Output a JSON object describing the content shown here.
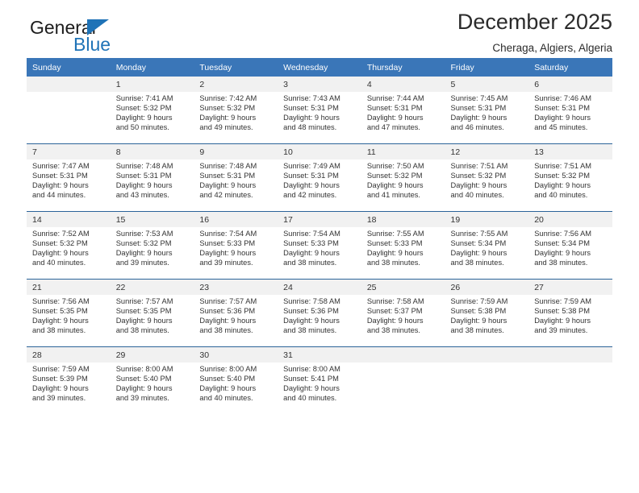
{
  "brand": {
    "name_part1": "General",
    "name_part2": "Blue",
    "triangle_icon": "triangle-icon",
    "accent_color": "#1f73b7"
  },
  "header": {
    "title": "December 2025",
    "subtitle": "Cheraga, Algiers, Algeria"
  },
  "calendar": {
    "header_bg": "#3a76b8",
    "daynum_bg": "#f1f1f1",
    "row_border_color": "#2b6399",
    "weekdays": [
      "Sunday",
      "Monday",
      "Tuesday",
      "Wednesday",
      "Thursday",
      "Friday",
      "Saturday"
    ],
    "weeks": [
      {
        "days": [
          {
            "num": "",
            "sunrise": "",
            "sunset": "",
            "daylight_line1": "",
            "daylight_line2": ""
          },
          {
            "num": "1",
            "sunrise": "Sunrise: 7:41 AM",
            "sunset": "Sunset: 5:32 PM",
            "daylight_line1": "Daylight: 9 hours",
            "daylight_line2": "and 50 minutes."
          },
          {
            "num": "2",
            "sunrise": "Sunrise: 7:42 AM",
            "sunset": "Sunset: 5:32 PM",
            "daylight_line1": "Daylight: 9 hours",
            "daylight_line2": "and 49 minutes."
          },
          {
            "num": "3",
            "sunrise": "Sunrise: 7:43 AM",
            "sunset": "Sunset: 5:31 PM",
            "daylight_line1": "Daylight: 9 hours",
            "daylight_line2": "and 48 minutes."
          },
          {
            "num": "4",
            "sunrise": "Sunrise: 7:44 AM",
            "sunset": "Sunset: 5:31 PM",
            "daylight_line1": "Daylight: 9 hours",
            "daylight_line2": "and 47 minutes."
          },
          {
            "num": "5",
            "sunrise": "Sunrise: 7:45 AM",
            "sunset": "Sunset: 5:31 PM",
            "daylight_line1": "Daylight: 9 hours",
            "daylight_line2": "and 46 minutes."
          },
          {
            "num": "6",
            "sunrise": "Sunrise: 7:46 AM",
            "sunset": "Sunset: 5:31 PM",
            "daylight_line1": "Daylight: 9 hours",
            "daylight_line2": "and 45 minutes."
          }
        ]
      },
      {
        "days": [
          {
            "num": "7",
            "sunrise": "Sunrise: 7:47 AM",
            "sunset": "Sunset: 5:31 PM",
            "daylight_line1": "Daylight: 9 hours",
            "daylight_line2": "and 44 minutes."
          },
          {
            "num": "8",
            "sunrise": "Sunrise: 7:48 AM",
            "sunset": "Sunset: 5:31 PM",
            "daylight_line1": "Daylight: 9 hours",
            "daylight_line2": "and 43 minutes."
          },
          {
            "num": "9",
            "sunrise": "Sunrise: 7:48 AM",
            "sunset": "Sunset: 5:31 PM",
            "daylight_line1": "Daylight: 9 hours",
            "daylight_line2": "and 42 minutes."
          },
          {
            "num": "10",
            "sunrise": "Sunrise: 7:49 AM",
            "sunset": "Sunset: 5:31 PM",
            "daylight_line1": "Daylight: 9 hours",
            "daylight_line2": "and 42 minutes."
          },
          {
            "num": "11",
            "sunrise": "Sunrise: 7:50 AM",
            "sunset": "Sunset: 5:32 PM",
            "daylight_line1": "Daylight: 9 hours",
            "daylight_line2": "and 41 minutes."
          },
          {
            "num": "12",
            "sunrise": "Sunrise: 7:51 AM",
            "sunset": "Sunset: 5:32 PM",
            "daylight_line1": "Daylight: 9 hours",
            "daylight_line2": "and 40 minutes."
          },
          {
            "num": "13",
            "sunrise": "Sunrise: 7:51 AM",
            "sunset": "Sunset: 5:32 PM",
            "daylight_line1": "Daylight: 9 hours",
            "daylight_line2": "and 40 minutes."
          }
        ]
      },
      {
        "days": [
          {
            "num": "14",
            "sunrise": "Sunrise: 7:52 AM",
            "sunset": "Sunset: 5:32 PM",
            "daylight_line1": "Daylight: 9 hours",
            "daylight_line2": "and 40 minutes."
          },
          {
            "num": "15",
            "sunrise": "Sunrise: 7:53 AM",
            "sunset": "Sunset: 5:32 PM",
            "daylight_line1": "Daylight: 9 hours",
            "daylight_line2": "and 39 minutes."
          },
          {
            "num": "16",
            "sunrise": "Sunrise: 7:54 AM",
            "sunset": "Sunset: 5:33 PM",
            "daylight_line1": "Daylight: 9 hours",
            "daylight_line2": "and 39 minutes."
          },
          {
            "num": "17",
            "sunrise": "Sunrise: 7:54 AM",
            "sunset": "Sunset: 5:33 PM",
            "daylight_line1": "Daylight: 9 hours",
            "daylight_line2": "and 38 minutes."
          },
          {
            "num": "18",
            "sunrise": "Sunrise: 7:55 AM",
            "sunset": "Sunset: 5:33 PM",
            "daylight_line1": "Daylight: 9 hours",
            "daylight_line2": "and 38 minutes."
          },
          {
            "num": "19",
            "sunrise": "Sunrise: 7:55 AM",
            "sunset": "Sunset: 5:34 PM",
            "daylight_line1": "Daylight: 9 hours",
            "daylight_line2": "and 38 minutes."
          },
          {
            "num": "20",
            "sunrise": "Sunrise: 7:56 AM",
            "sunset": "Sunset: 5:34 PM",
            "daylight_line1": "Daylight: 9 hours",
            "daylight_line2": "and 38 minutes."
          }
        ]
      },
      {
        "days": [
          {
            "num": "21",
            "sunrise": "Sunrise: 7:56 AM",
            "sunset": "Sunset: 5:35 PM",
            "daylight_line1": "Daylight: 9 hours",
            "daylight_line2": "and 38 minutes."
          },
          {
            "num": "22",
            "sunrise": "Sunrise: 7:57 AM",
            "sunset": "Sunset: 5:35 PM",
            "daylight_line1": "Daylight: 9 hours",
            "daylight_line2": "and 38 minutes."
          },
          {
            "num": "23",
            "sunrise": "Sunrise: 7:57 AM",
            "sunset": "Sunset: 5:36 PM",
            "daylight_line1": "Daylight: 9 hours",
            "daylight_line2": "and 38 minutes."
          },
          {
            "num": "24",
            "sunrise": "Sunrise: 7:58 AM",
            "sunset": "Sunset: 5:36 PM",
            "daylight_line1": "Daylight: 9 hours",
            "daylight_line2": "and 38 minutes."
          },
          {
            "num": "25",
            "sunrise": "Sunrise: 7:58 AM",
            "sunset": "Sunset: 5:37 PM",
            "daylight_line1": "Daylight: 9 hours",
            "daylight_line2": "and 38 minutes."
          },
          {
            "num": "26",
            "sunrise": "Sunrise: 7:59 AM",
            "sunset": "Sunset: 5:38 PM",
            "daylight_line1": "Daylight: 9 hours",
            "daylight_line2": "and 38 minutes."
          },
          {
            "num": "27",
            "sunrise": "Sunrise: 7:59 AM",
            "sunset": "Sunset: 5:38 PM",
            "daylight_line1": "Daylight: 9 hours",
            "daylight_line2": "and 39 minutes."
          }
        ]
      },
      {
        "days": [
          {
            "num": "28",
            "sunrise": "Sunrise: 7:59 AM",
            "sunset": "Sunset: 5:39 PM",
            "daylight_line1": "Daylight: 9 hours",
            "daylight_line2": "and 39 minutes."
          },
          {
            "num": "29",
            "sunrise": "Sunrise: 8:00 AM",
            "sunset": "Sunset: 5:40 PM",
            "daylight_line1": "Daylight: 9 hours",
            "daylight_line2": "and 39 minutes."
          },
          {
            "num": "30",
            "sunrise": "Sunrise: 8:00 AM",
            "sunset": "Sunset: 5:40 PM",
            "daylight_line1": "Daylight: 9 hours",
            "daylight_line2": "and 40 minutes."
          },
          {
            "num": "31",
            "sunrise": "Sunrise: 8:00 AM",
            "sunset": "Sunset: 5:41 PM",
            "daylight_line1": "Daylight: 9 hours",
            "daylight_line2": "and 40 minutes."
          },
          {
            "num": "",
            "sunrise": "",
            "sunset": "",
            "daylight_line1": "",
            "daylight_line2": ""
          },
          {
            "num": "",
            "sunrise": "",
            "sunset": "",
            "daylight_line1": "",
            "daylight_line2": ""
          },
          {
            "num": "",
            "sunrise": "",
            "sunset": "",
            "daylight_line1": "",
            "daylight_line2": ""
          }
        ]
      }
    ]
  }
}
